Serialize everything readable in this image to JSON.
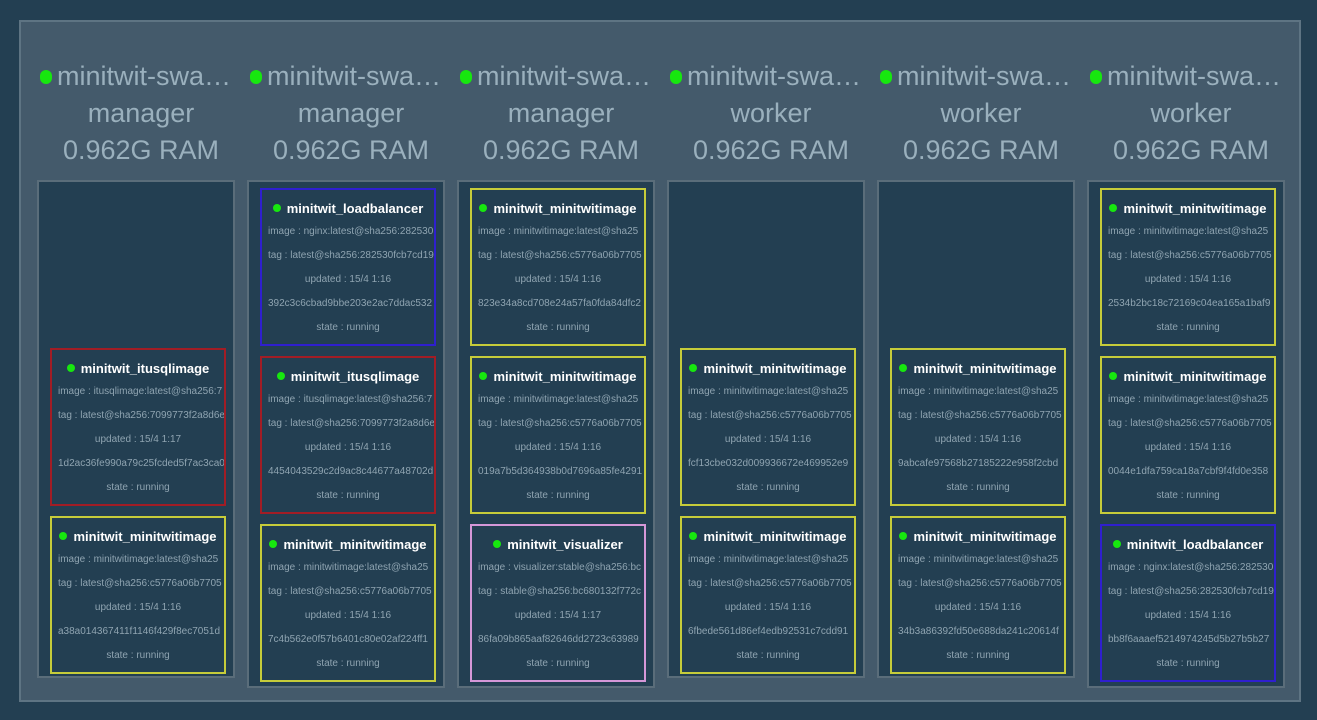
{
  "nodes": [
    {
      "name": "minitwit-swa…",
      "role": "manager",
      "ram": "0.962G RAM",
      "tasks": [
        {
          "name": "minitwit_itusqlimage",
          "image": "image : itusqlimage:latest@sha256:7",
          "tag": "tag : latest@sha256:7099773f2a8d6e",
          "updated": "updated : 15/4 1:17",
          "id": "1d2ac36fe990a79c25fcded5f7ac3ca0",
          "state": "state : running",
          "color": "#a11d25"
        },
        {
          "name": "minitwit_minitwitimage",
          "image": "image : minitwitimage:latest@sha25",
          "tag": "tag : latest@sha256:c5776a06b7705",
          "updated": "updated : 15/4 1:16",
          "id": "a38a014367411f1146f429f8ec7051d",
          "state": "state : running",
          "color": "#c6cc3a"
        }
      ]
    },
    {
      "name": "minitwit-swa…",
      "role": "manager",
      "ram": "0.962G RAM",
      "tasks": [
        {
          "name": "minitwit_loadbalancer",
          "image": "image : nginx:latest@sha256:282530",
          "tag": "tag : latest@sha256:282530fcb7cd19",
          "updated": "updated : 15/4 1:16",
          "id": "392c3c6cbad9bbe203e2ac7ddac532",
          "state": "state : running",
          "color": "#2f1fcf"
        },
        {
          "name": "minitwit_itusqlimage",
          "image": "image : itusqlimage:latest@sha256:7",
          "tag": "tag : latest@sha256:7099773f2a8d6e",
          "updated": "updated : 15/4 1:16",
          "id": "4454043529c2d9ac8c44677a48702d",
          "state": "state : running",
          "color": "#a11d25"
        },
        {
          "name": "minitwit_minitwitimage",
          "image": "image : minitwitimage:latest@sha25",
          "tag": "tag : latest@sha256:c5776a06b7705",
          "updated": "updated : 15/4 1:16",
          "id": "7c4b562e0f57b6401c80e02af224ff1",
          "state": "state : running",
          "color": "#c6cc3a"
        }
      ]
    },
    {
      "name": "minitwit-swa…",
      "role": "manager",
      "ram": "0.962G RAM",
      "tasks": [
        {
          "name": "minitwit_minitwitimage",
          "image": "image : minitwitimage:latest@sha25",
          "tag": "tag : latest@sha256:c5776a06b7705",
          "updated": "updated : 15/4 1:16",
          "id": "823e34a8cd708e24a57fa0fda84dfc2",
          "state": "state : running",
          "color": "#c6cc3a"
        },
        {
          "name": "minitwit_minitwitimage",
          "image": "image : minitwitimage:latest@sha25",
          "tag": "tag : latest@sha256:c5776a06b7705",
          "updated": "updated : 15/4 1:16",
          "id": "019a7b5d364938b0d7696a85fe4291",
          "state": "state : running",
          "color": "#c6cc3a"
        },
        {
          "name": "minitwit_visualizer",
          "image": "image : visualizer:stable@sha256:bc",
          "tag": "tag : stable@sha256:bc680132f772c",
          "updated": "updated : 15/4 1:17",
          "id": "86fa09b865aaf82646dd2723c63989",
          "state": "state : running",
          "color": "#d597d8"
        }
      ]
    },
    {
      "name": "minitwit-swa…",
      "role": "worker",
      "ram": "0.962G RAM",
      "tasks": [
        {
          "name": "minitwit_minitwitimage",
          "image": "image : minitwitimage:latest@sha25",
          "tag": "tag : latest@sha256:c5776a06b7705",
          "updated": "updated : 15/4 1:16",
          "id": "fcf13cbe032d009936672e469952e9",
          "state": "state : running",
          "color": "#c6cc3a"
        },
        {
          "name": "minitwit_minitwitimage",
          "image": "image : minitwitimage:latest@sha25",
          "tag": "tag : latest@sha256:c5776a06b7705",
          "updated": "updated : 15/4 1:16",
          "id": "6fbede561d86ef4edb92531c7cdd91",
          "state": "state : running",
          "color": "#c6cc3a"
        }
      ]
    },
    {
      "name": "minitwit-swa…",
      "role": "worker",
      "ram": "0.962G RAM",
      "tasks": [
        {
          "name": "minitwit_minitwitimage",
          "image": "image : minitwitimage:latest@sha25",
          "tag": "tag : latest@sha256:c5776a06b7705",
          "updated": "updated : 15/4 1:16",
          "id": "9abcafe97568b27185222e958f2cbd",
          "state": "state : running",
          "color": "#c6cc3a"
        },
        {
          "name": "minitwit_minitwitimage",
          "image": "image : minitwitimage:latest@sha25",
          "tag": "tag : latest@sha256:c5776a06b7705",
          "updated": "updated : 15/4 1:16",
          "id": "34b3a86392fd50e688da241c20614f",
          "state": "state : running",
          "color": "#c6cc3a"
        }
      ]
    },
    {
      "name": "minitwit-swa…",
      "role": "worker",
      "ram": "0.962G RAM",
      "tasks": [
        {
          "name": "minitwit_minitwitimage",
          "image": "image : minitwitimage:latest@sha25",
          "tag": "tag : latest@sha256:c5776a06b7705",
          "updated": "updated : 15/4 1:16",
          "id": "2534b2bc18c72169c04ea165a1baf9",
          "state": "state : running",
          "color": "#c6cc3a"
        },
        {
          "name": "minitwit_minitwitimage",
          "image": "image : minitwitimage:latest@sha25",
          "tag": "tag : latest@sha256:c5776a06b7705",
          "updated": "updated : 15/4 1:16",
          "id": "0044e1dfa759ca18a7cbf9f4fd0e358",
          "state": "state : running",
          "color": "#c6cc3a"
        },
        {
          "name": "minitwit_loadbalancer",
          "image": "image : nginx:latest@sha256:282530",
          "tag": "tag : latest@sha256:282530fcb7cd19",
          "updated": "updated : 15/4 1:16",
          "id": "bb8f6aaaef5214974245d5b27b5b27",
          "state": "state : running",
          "color": "#2f1fcf"
        }
      ]
    }
  ]
}
